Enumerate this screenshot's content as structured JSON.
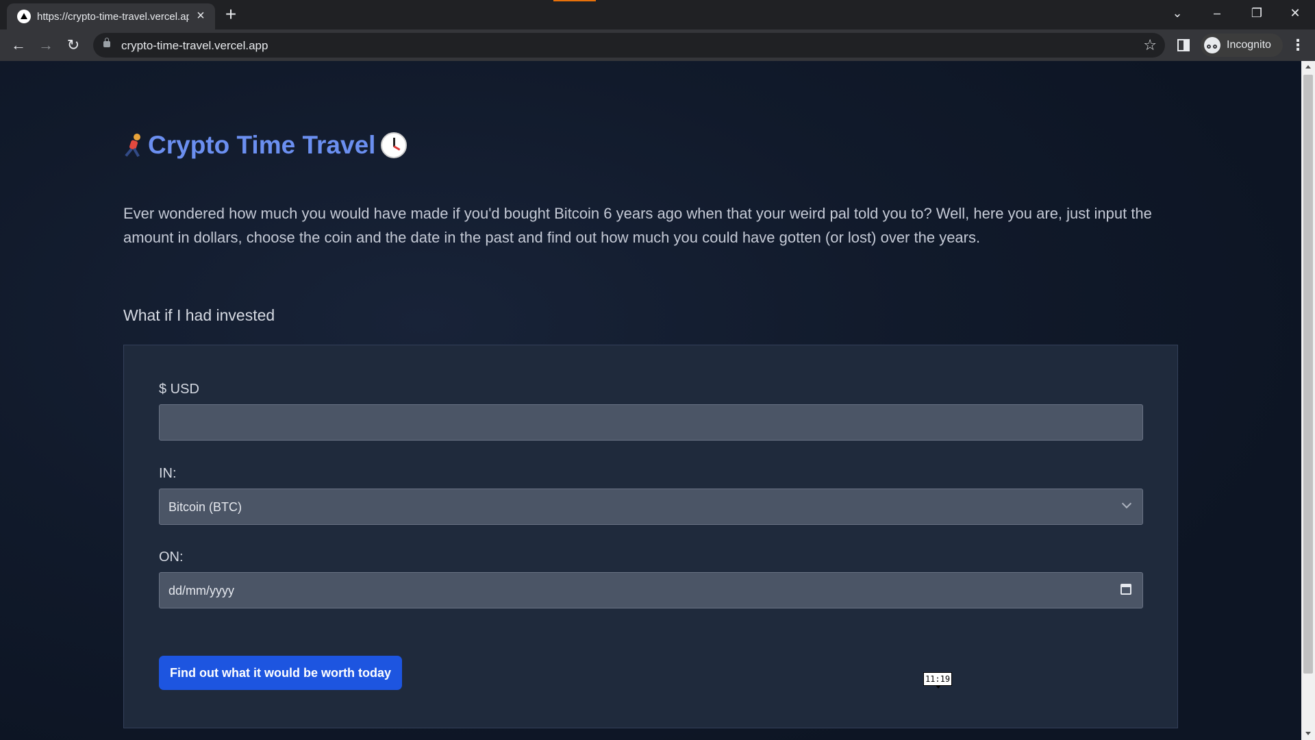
{
  "browser": {
    "tab_title": "https://crypto-time-travel.vercel.app",
    "url": "crypto-time-travel.vercel.app",
    "profile_label": "Incognito",
    "icons": [
      "favicon-icon",
      "close-icon",
      "plus-icon",
      "back-icon",
      "forward-icon",
      "reload-icon",
      "lock-icon",
      "star-icon",
      "side-panel-icon",
      "incognito-icon",
      "menu-icon",
      "minimize-icon",
      "restore-icon",
      "window-close-icon",
      "tab-search-icon"
    ]
  },
  "page": {
    "title": "Crypto Time Travel",
    "title_emoji_left": "runner",
    "title_emoji_right": "clock",
    "intro": "Ever wondered how much you would have made if you'd bought Bitcoin 6 years ago when that your weird pal told you to? Well, here you are, just input the amount in dollars, choose the coin and the date in the past and find out how much you could have gotten (or lost) over the years.",
    "section_label": "What if I had invested"
  },
  "form": {
    "amount_label": "$ USD",
    "amount_value": "",
    "coin_label": "IN:",
    "coin_value": "Bitcoin (BTC)",
    "date_label": "ON:",
    "date_placeholder": "dd/mm/yyyy",
    "submit_label": "Find out what it would be worth today"
  },
  "overlay": {
    "time_badge": "11:19"
  },
  "colors": {
    "title": "#6b8ff0",
    "button": "#1d55e0",
    "page_bg": "#111a2b",
    "card_bg": "#1f2a3c",
    "input_bg": "#4b5566"
  }
}
